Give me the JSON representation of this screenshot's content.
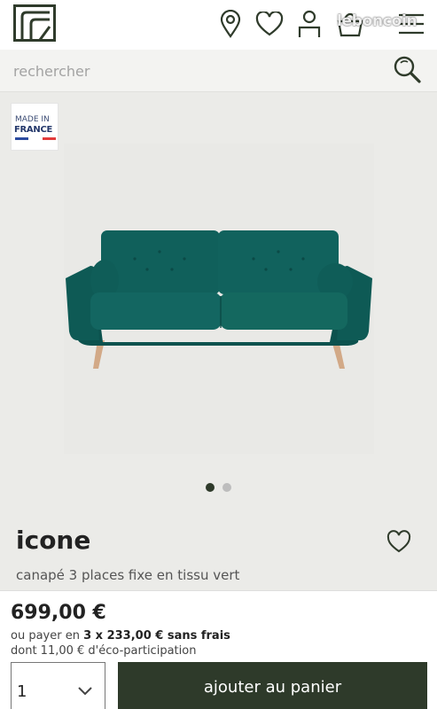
{
  "header": {
    "icons": [
      "store-locator-icon",
      "heart-icon",
      "account-icon",
      "basket-icon",
      "menu-icon"
    ],
    "watermark": "leboncoin"
  },
  "search": {
    "placeholder": "rechercher"
  },
  "gallery": {
    "badge_line1": "MADE IN",
    "badge_line2": "FRANCE",
    "flag_colors": [
      "#2b4aa0",
      "#ffffff",
      "#e23b3b"
    ],
    "slide_count": 2,
    "active_slide": 1
  },
  "product": {
    "name": "icone",
    "description": "canapé 3 places fixe en tissu vert"
  },
  "purchase": {
    "price": "699,00 €",
    "installment_prefix": "ou payer en",
    "installment_value": "3 x 233,00 € sans frais",
    "eco_participation": "dont 11,00 € d'éco-participation",
    "quantity": "1",
    "add_to_cart_label": "ajouter au panier"
  },
  "colors": {
    "brand": "#2e3a2a",
    "sofa": "#0f5b57"
  }
}
